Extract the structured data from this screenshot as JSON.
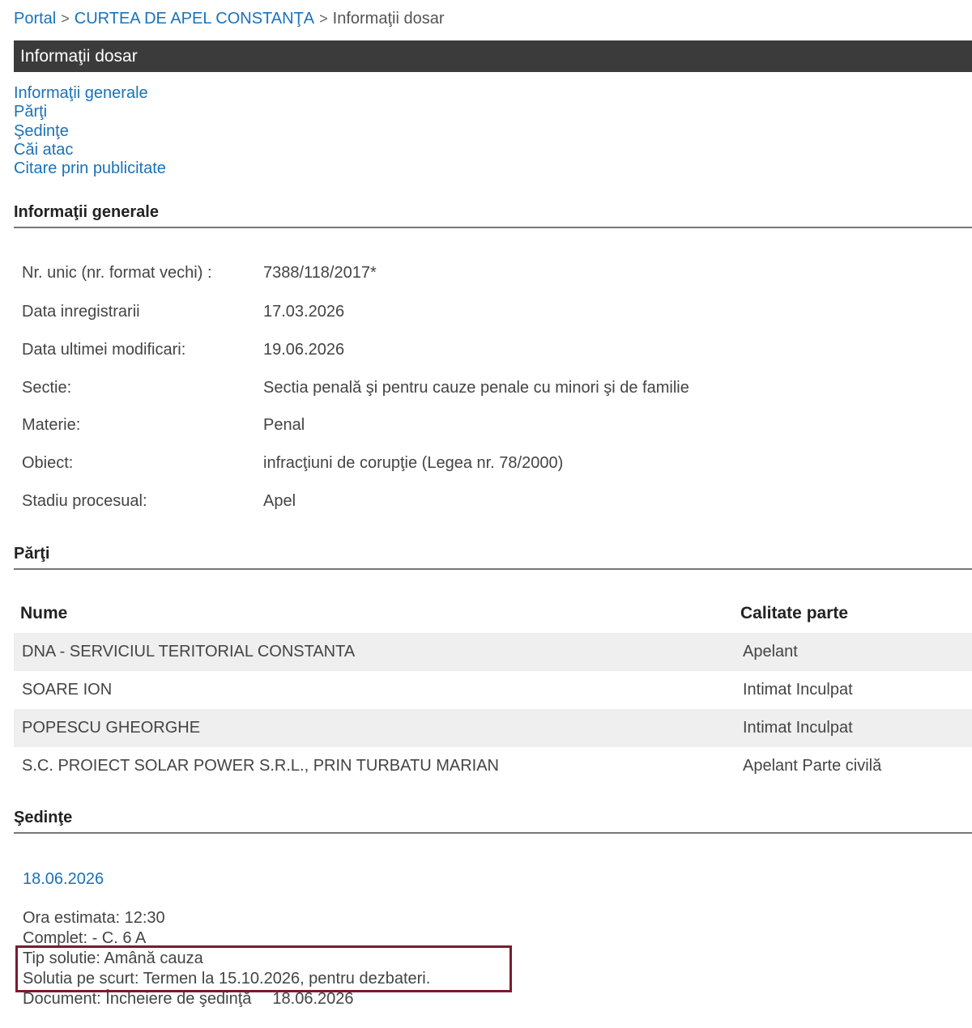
{
  "breadcrumb": {
    "portal": "Portal",
    "court": "CURTEA DE APEL CONSTANŢA",
    "current": "Informaţii dosar",
    "separator": ">"
  },
  "page_title": "Informaţii dosar",
  "quick_nav": [
    "Informaţii generale",
    "Părţi",
    "Şedinţe",
    "Căi atac",
    "Citare prin publicitate"
  ],
  "general": {
    "title": "Informaţii generale",
    "rows": [
      {
        "label": "Nr. unic (nr. format vechi) :",
        "value": "7388/118/2017*"
      },
      {
        "label": "Data inregistrarii",
        "value": "17.03.2026"
      },
      {
        "label": "Data ultimei modificari:",
        "value": "19.06.2026"
      },
      {
        "label": "Sectie:",
        "value": "Sectia penală şi pentru cauze penale cu minori şi de familie"
      },
      {
        "label": "Materie:",
        "value": "Penal"
      },
      {
        "label": "Obiect:",
        "value": "infracţiuni de corupţie (Legea nr. 78/2000)"
      },
      {
        "label": "Stadiu procesual:",
        "value": "Apel"
      }
    ]
  },
  "parties": {
    "title": "Părţi",
    "columns": [
      "Nume",
      "Calitate parte"
    ],
    "rows": [
      {
        "name": "DNA - SERVICIUL TERITORIAL CONSTANTA",
        "role": "Apelant"
      },
      {
        "name": "SOARE ION",
        "role": "Intimat Inculpat"
      },
      {
        "name": "POPESCU GHEORGHE",
        "role": "Intimat Inculpat"
      },
      {
        "name": "S.C. PROIECT SOLAR POWER S.R.L., PRIN TURBATU MARIAN",
        "role": "Apelant Parte civilă"
      }
    ]
  },
  "hearings": {
    "title": "Şedinţe",
    "date": "18.06.2026",
    "ora": "Ora estimata: 12:30",
    "complet": "Complet: - C. 6 A",
    "tip_solutie": "Tip solutie: Amână cauza",
    "solutia": "Solutia pe scurt: Termen la 15.10.2026, pentru dezbateri.",
    "document": "Document: Încheiere de şedinţă",
    "document_date": "18.06.2026"
  },
  "colors": {
    "link": "#1a72b8",
    "title_bar": "#3b3b3b",
    "highlight_border": "#7b1b2e",
    "row_shade": "#efefef"
  }
}
